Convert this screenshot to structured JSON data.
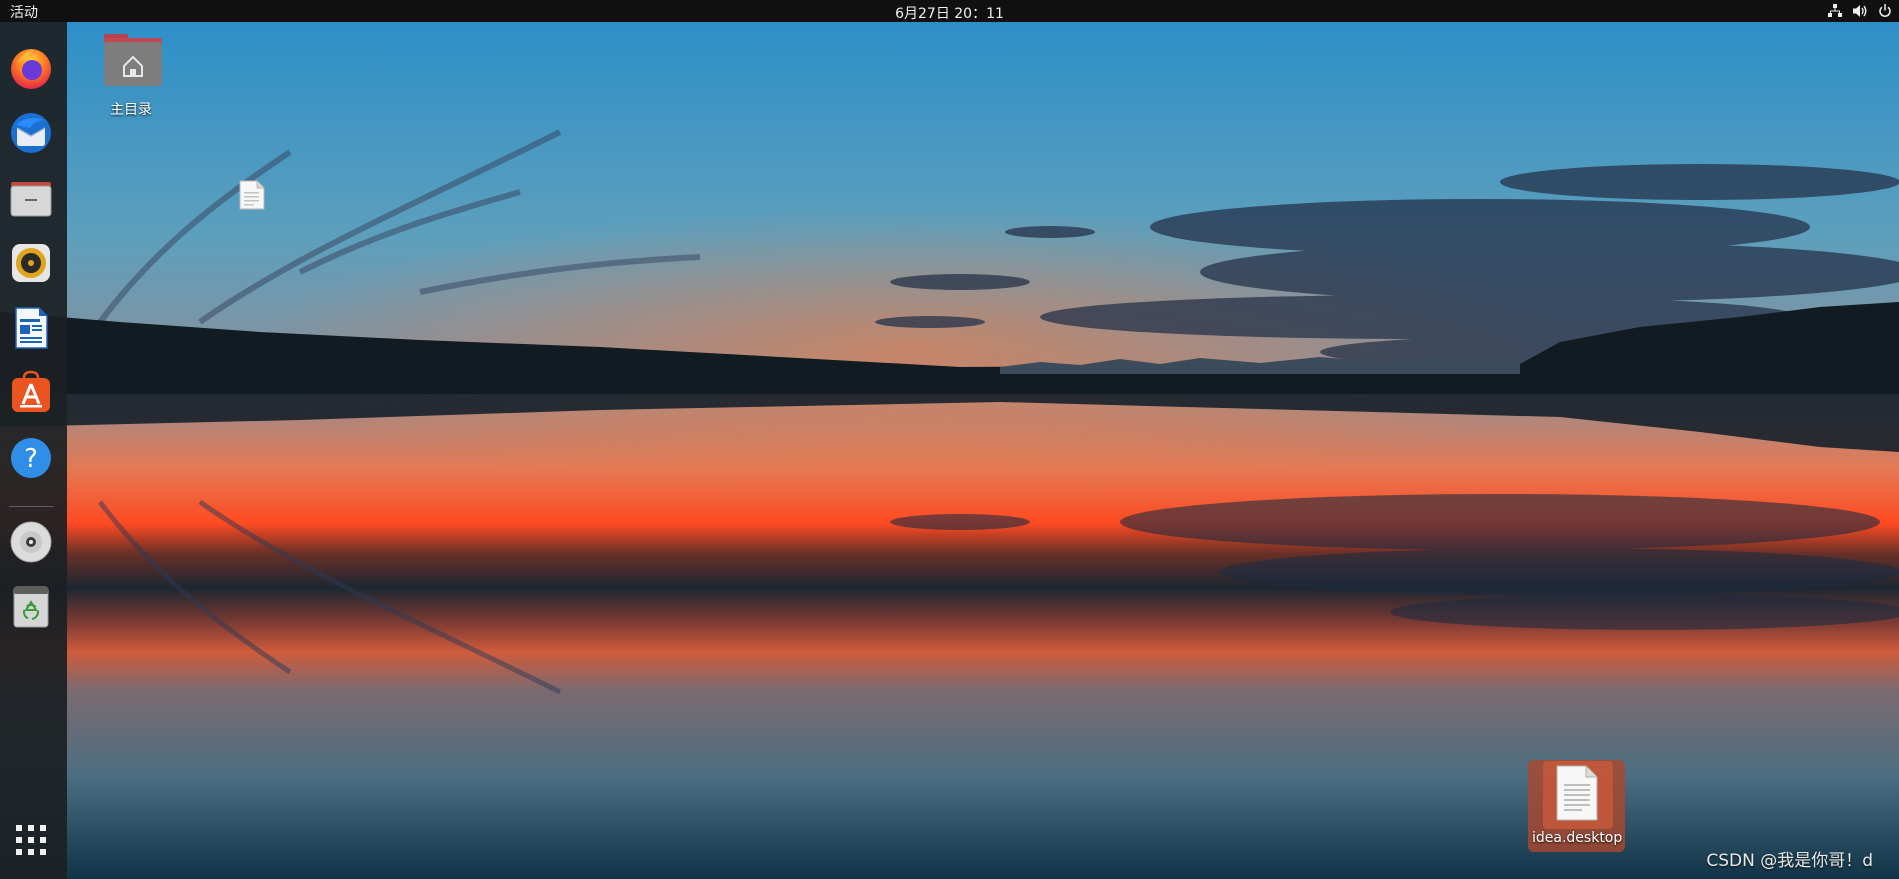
{
  "topbar": {
    "activities_label": "活动",
    "clock": "6月27日  20：11",
    "tray_icons": [
      "network-icon",
      "volume-icon",
      "power-icon"
    ]
  },
  "dock": {
    "items": [
      {
        "name": "firefox",
        "icon": "firefox-icon"
      },
      {
        "name": "thunderbird",
        "icon": "thunderbird-icon"
      },
      {
        "name": "files",
        "icon": "files-icon"
      },
      {
        "name": "rhythmbox",
        "icon": "rhythmbox-icon"
      },
      {
        "name": "libreoffice-writer",
        "icon": "writer-icon"
      },
      {
        "name": "ubuntu-software",
        "icon": "software-icon"
      },
      {
        "name": "help",
        "icon": "help-icon"
      },
      {
        "name": "optical-disc",
        "icon": "disc-icon"
      },
      {
        "name": "trash",
        "icon": "trash-icon"
      },
      {
        "name": "show-applications",
        "icon": "app-grid-icon"
      }
    ]
  },
  "desktop": {
    "home_label": "主目录",
    "idea_label": "idea.desktop"
  },
  "watermark": "CSDN @我是你哥！d",
  "colors": {
    "topbar": "#101010",
    "dock": "#1c2024",
    "selection": "#aa482e",
    "sky_top": "#2d8fc8",
    "sunset": "#ff5a2a",
    "water": "#153a4e"
  }
}
